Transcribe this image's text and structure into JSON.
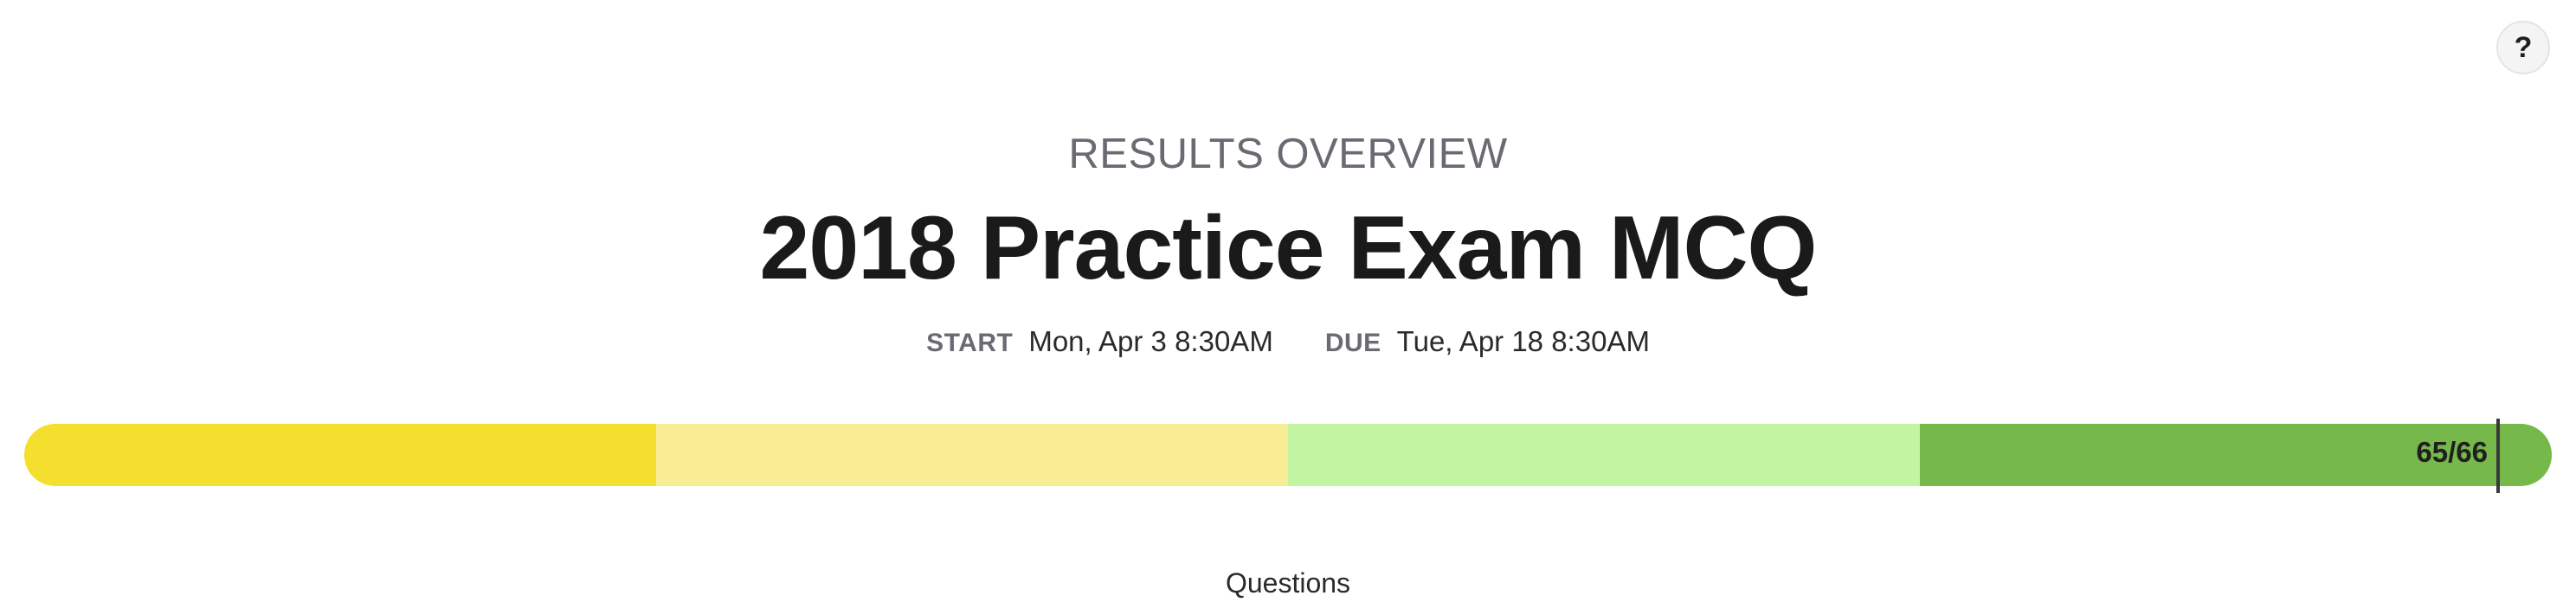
{
  "help": {
    "label": "?"
  },
  "header": {
    "kicker": "RESULTS OVERVIEW",
    "title": "2018 Practice Exam MCQ"
  },
  "schedule": {
    "start_label": "START",
    "start_value": "Mon, Apr 3 8:30AM",
    "due_label": "DUE",
    "due_value": "Tue, Apr 18 8:30AM"
  },
  "progress": {
    "label": "65/66",
    "answered": 65,
    "total": 66,
    "segments": [
      {
        "color": "#f4de2e"
      },
      {
        "color": "#f8ec94"
      },
      {
        "color": "#c3f4a1"
      },
      {
        "color": "#76b849"
      }
    ]
  },
  "footer": {
    "label": "Questions"
  }
}
